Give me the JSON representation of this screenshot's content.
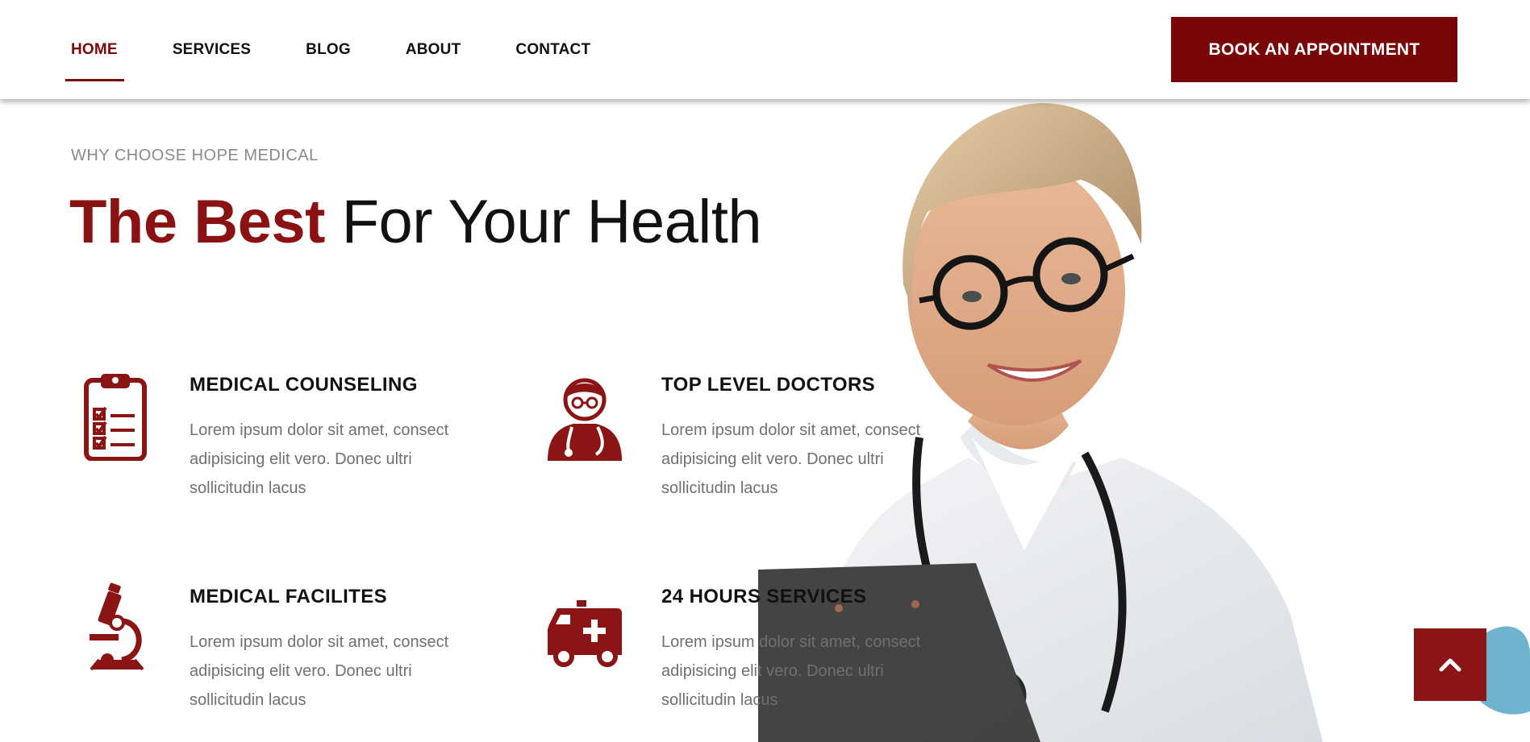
{
  "nav": {
    "items": [
      {
        "label": "HOME",
        "active": true
      },
      {
        "label": "SERVICES"
      },
      {
        "label": "BLOG"
      },
      {
        "label": "ABOUT"
      },
      {
        "label": "CONTACT"
      }
    ],
    "cta_label": "BOOK AN APPOINTMENT"
  },
  "hero": {
    "eyebrow": "WHY CHOOSE HOPE MEDICAL",
    "headline_strong": "The Best",
    "headline_light": "For Your Health"
  },
  "features": [
    {
      "icon": "clipboard-checklist-icon",
      "title": "MEDICAL COUNSELING",
      "text": "Lorem ipsum dolor sit amet, consect adipisicing elit vero. Donec ultri sollicitudin lacus"
    },
    {
      "icon": "doctor-icon",
      "title": "TOP LEVEL DOCTORS",
      "text": "Lorem ipsum dolor sit amet, consect adipisicing elit vero. Donec ultri sollicitudin lacus"
    },
    {
      "icon": "microscope-icon",
      "title": "MEDICAL FACILITES",
      "text": "Lorem ipsum dolor sit amet, consect adipisicing elit vero. Donec ultri sollicitudin lacus"
    },
    {
      "icon": "ambulance-icon",
      "title": "24 HOURS SERVICES",
      "text": "Lorem ipsum dolor sit amet, consect adipisicing elit vero. Donec ultri sollicitudin lacus"
    }
  ],
  "colors": {
    "brand": "#790606",
    "accent": "#8b1212",
    "muted_text": "#707070",
    "eyebrow": "#8a8a8a"
  },
  "icons": {
    "scroll_top": "chevron-up-icon"
  }
}
